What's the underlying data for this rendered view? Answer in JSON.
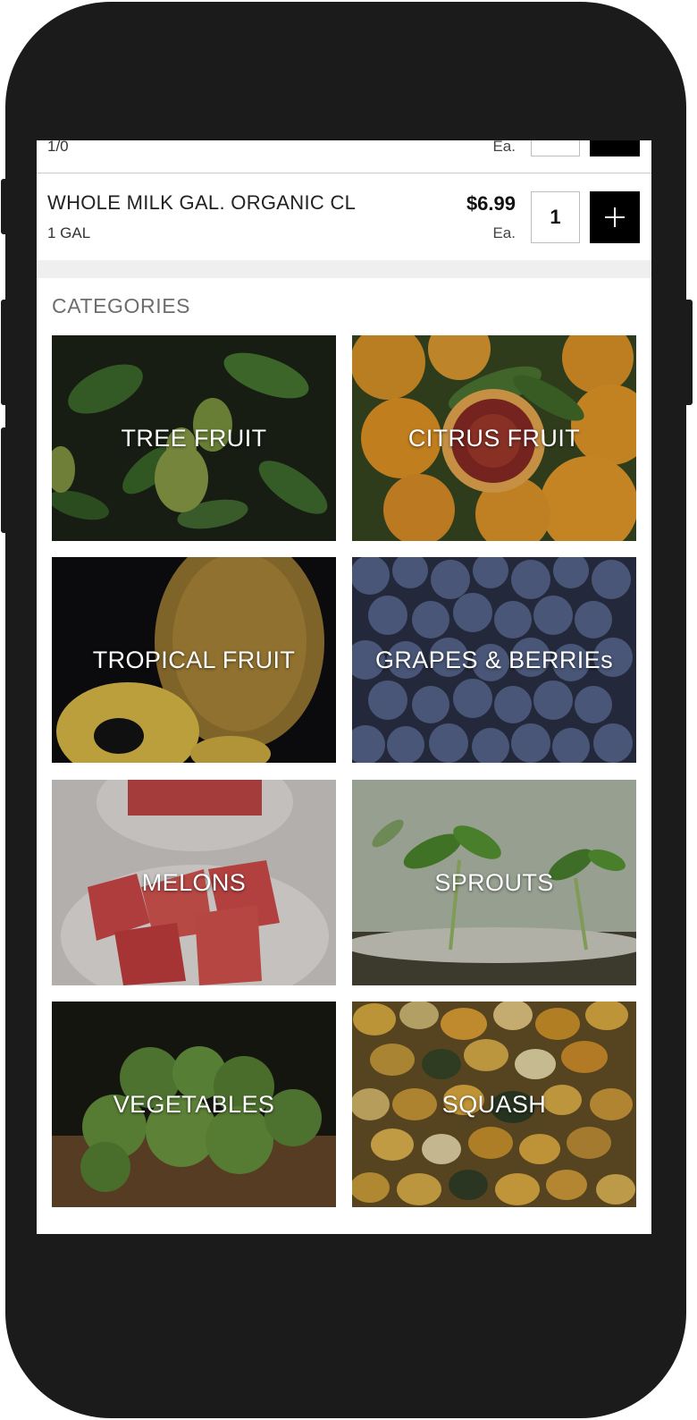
{
  "cart": {
    "items": [
      {
        "name": "",
        "size": "1/0",
        "price": "",
        "unit": "Ea.",
        "qty": ""
      },
      {
        "name": "WHOLE MILK GAL. ORGANIC CL",
        "size": "1 GAL",
        "price": "$6.99",
        "unit": "Ea.",
        "qty": "1"
      }
    ]
  },
  "categories": {
    "header": "CATEGORIES",
    "tiles": [
      {
        "label": "TREE FRUIT",
        "image": "pears-on-branch"
      },
      {
        "label": "CITRUS FRUIT",
        "image": "oranges-and-blood-orange"
      },
      {
        "label": "TROPICAL FRUIT",
        "image": "pineapple"
      },
      {
        "label": "GRAPES & BERRIEs",
        "image": "blueberries"
      },
      {
        "label": "MELONS",
        "image": "watermelon-cubes"
      },
      {
        "label": "SPROUTS",
        "image": "seedlings"
      },
      {
        "label": "VEGETABLES",
        "image": "brussels-sprouts"
      },
      {
        "label": "SQUASH",
        "image": "gourds"
      }
    ]
  },
  "colors": {
    "device_frame": "#1b1b1b",
    "accent_button": "#000000",
    "background": "#ffffff",
    "section_gap": "#efefef"
  }
}
